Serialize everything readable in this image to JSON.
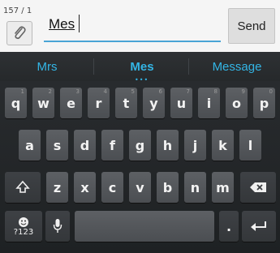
{
  "compose": {
    "counter": "157 / 1",
    "message_text": "Mes",
    "send_label": "Send"
  },
  "suggestions": [
    "Mrs",
    "Mes",
    "Message"
  ],
  "suggest_dots": "•••",
  "rows": {
    "row1": [
      "q",
      "w",
      "e",
      "r",
      "t",
      "y",
      "u",
      "i",
      "o",
      "p"
    ],
    "row1_hints": [
      "1",
      "2",
      "3",
      "4",
      "5",
      "6",
      "7",
      "8",
      "9",
      "0"
    ],
    "row2": [
      "a",
      "s",
      "d",
      "f",
      "g",
      "h",
      "j",
      "k",
      "l"
    ],
    "row3": [
      "z",
      "x",
      "c",
      "v",
      "b",
      "n",
      "m"
    ]
  },
  "special": {
    "symbols_label": "?123",
    "period_label": "."
  },
  "icons": {
    "attach": "paperclip-icon",
    "shift": "shift-icon",
    "delete": "backspace-icon",
    "emoji": "emoji-icon",
    "mic": "microphone-icon",
    "enter": "enter-icon"
  },
  "colors": {
    "accent": "#33b5e5",
    "key_bg": "#5d6064",
    "keyboard_bg": "#222528"
  }
}
